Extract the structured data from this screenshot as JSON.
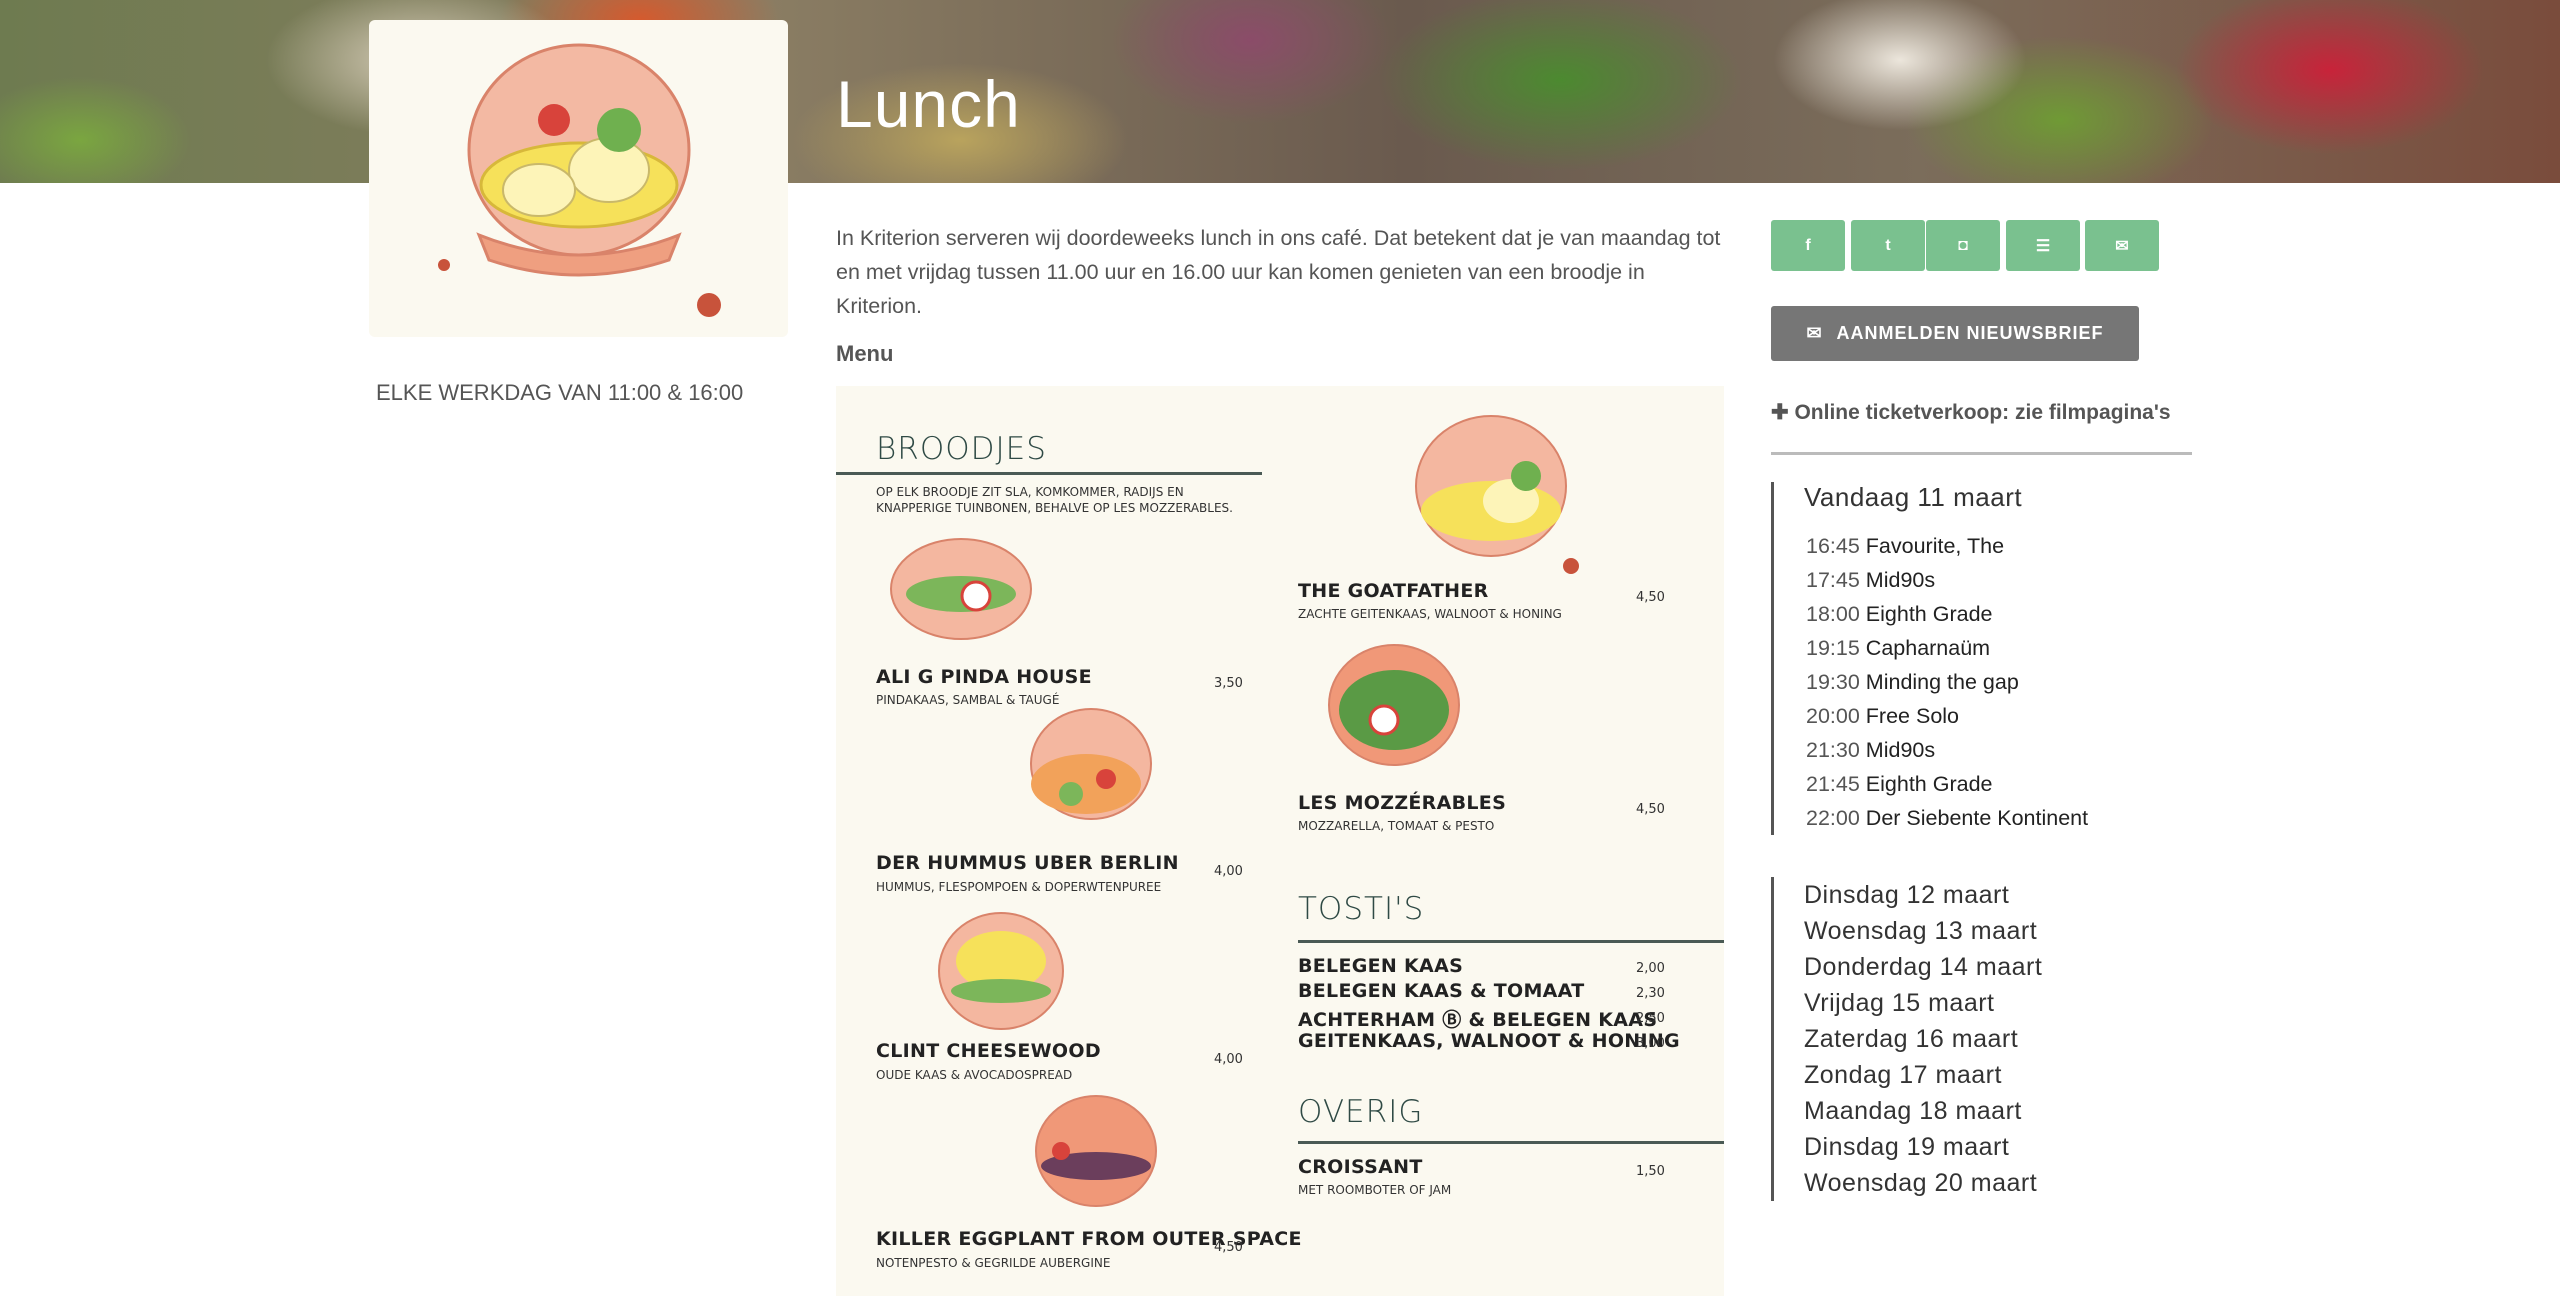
{
  "page": {
    "title": "Lunch",
    "hours": "ELKE WERKDAG VAN 11:00 & 16:00",
    "intro": "In Kriterion serveren wij doordeweeks lunch in ons café. Dat betekent dat je van maandag tot en met vrijdag tussen 11.00 uur en 16.00 uur kan komen genieten van een broodje in Kriterion.",
    "menu_label": "Menu"
  },
  "menu": {
    "broodjes": {
      "heading": "BROODJES",
      "note": "OP ELK BROODJE ZIT SLA, KOMKOMMER, RADIJS EN KNAPPERIGE TUINBONEN, BEHALVE OP LES MOZZERABLES.",
      "items": [
        {
          "name": "ALI G PINDA HOUSE",
          "desc": "PINDAKAAS, SAMBAL & TAUGÉ",
          "price": "3,50"
        },
        {
          "name": "DER HUMMUS UBER BERLIN",
          "desc": "HUMMUS, FLESPOMPOEN & DOPERWTENPUREE",
          "price": "4,00"
        },
        {
          "name": "CLINT CHEESEWOOD",
          "desc": "OUDE KAAS & AVOCADOSPREAD",
          "price": "4,00"
        },
        {
          "name": "KILLER EGGPLANT FROM OUTER SPACE",
          "desc": "NOTENPESTO & GEGRILDE AUBERGINE",
          "price": "4,50"
        }
      ]
    },
    "right": {
      "items": [
        {
          "name": "THE GOATFATHER",
          "desc": "ZACHTE GEITENKAAS, WALNOOT & HONING",
          "price": "4,50"
        },
        {
          "name": "LES MOZZÉRABLES",
          "desc": "MOZZARELLA, TOMAAT & PESTO",
          "price": "4,50"
        }
      ]
    },
    "tostis": {
      "heading": "TOSTI'S",
      "items": [
        {
          "name": "BELEGEN KAAS",
          "price": "2,00"
        },
        {
          "name": "BELEGEN KAAS & TOMAAT",
          "price": "2,30"
        },
        {
          "name": "ACHTERHAM Ⓑ & BELEGEN KAAS",
          "price": "2,50"
        },
        {
          "name": "GEITENKAAS, WALNOOT & HONING",
          "price": "3,00"
        }
      ]
    },
    "overig": {
      "heading": "OVERIG",
      "items": [
        {
          "name": "CROISSANT",
          "desc": "MET ROOMBOTER OF JAM",
          "price": "1,50"
        }
      ]
    }
  },
  "social": [
    {
      "icon": "facebook-icon",
      "glyph": "f"
    },
    {
      "icon": "twitter-icon",
      "glyph": "t"
    },
    {
      "icon": "instagram-icon",
      "glyph": "◘"
    },
    {
      "icon": "spotify-icon",
      "glyph": "☰"
    },
    {
      "icon": "mail-icon",
      "glyph": "✉"
    }
  ],
  "newsletter_label": "AANMELDEN NIEUWSBRIEF",
  "tickets_label": "Online ticketverkoop: zie filmpagina's",
  "today": {
    "title": "Vandaag 11 maart",
    "shows": [
      {
        "time": "16:45",
        "title": "Favourite, The"
      },
      {
        "time": "17:45",
        "title": "Mid90s"
      },
      {
        "time": "18:00",
        "title": "Eighth Grade"
      },
      {
        "time": "19:15",
        "title": "Capharnaüm"
      },
      {
        "time": "19:30",
        "title": "Minding the gap"
      },
      {
        "time": "20:00",
        "title": "Free Solo"
      },
      {
        "time": "21:30",
        "title": "Mid90s"
      },
      {
        "time": "21:45",
        "title": "Eighth Grade"
      },
      {
        "time": "22:00",
        "title": "Der Siebente Kontinent"
      }
    ]
  },
  "days": [
    "Dinsdag 12 maart",
    "Woensdag 13 maart",
    "Donderdag 14 maart",
    "Vrijdag 15 maart",
    "Zaterdag 16 maart",
    "Zondag 17 maart",
    "Maandag 18 maart",
    "Dinsdag 19 maart",
    "Woensdag 20 maart"
  ],
  "colors": {
    "social_green": "#7ac18f",
    "newsletter_grey": "#767676",
    "menu_bg": "#fbf9f0"
  }
}
